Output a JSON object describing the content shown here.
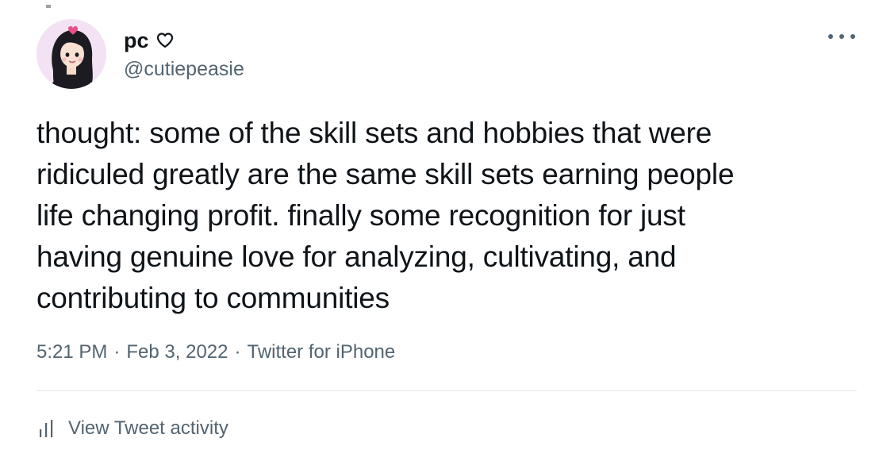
{
  "user": {
    "display_name": "pc",
    "handle": "@cutiepeasie",
    "avatar_icon": "avatar-illustration"
  },
  "tweet": {
    "text": "thought: some of the skill sets and hobbies that were\nridiculed greatly are the same skill sets earning people\nlife changing profit. finally some recognition for just\nhaving genuine love for analyzing, cultivating, and\ncontributing to communities"
  },
  "meta": {
    "time": "5:21 PM",
    "date": "Feb 3, 2022",
    "source": "Twitter for iPhone",
    "separator": "·"
  },
  "actions": {
    "more_icon": "more-horizontal-icon",
    "view_activity_label": "View Tweet activity",
    "activity_icon": "stats-icon"
  },
  "colors": {
    "text_primary": "#0f1419",
    "text_secondary": "#536471",
    "divider": "#e7e9ea"
  }
}
